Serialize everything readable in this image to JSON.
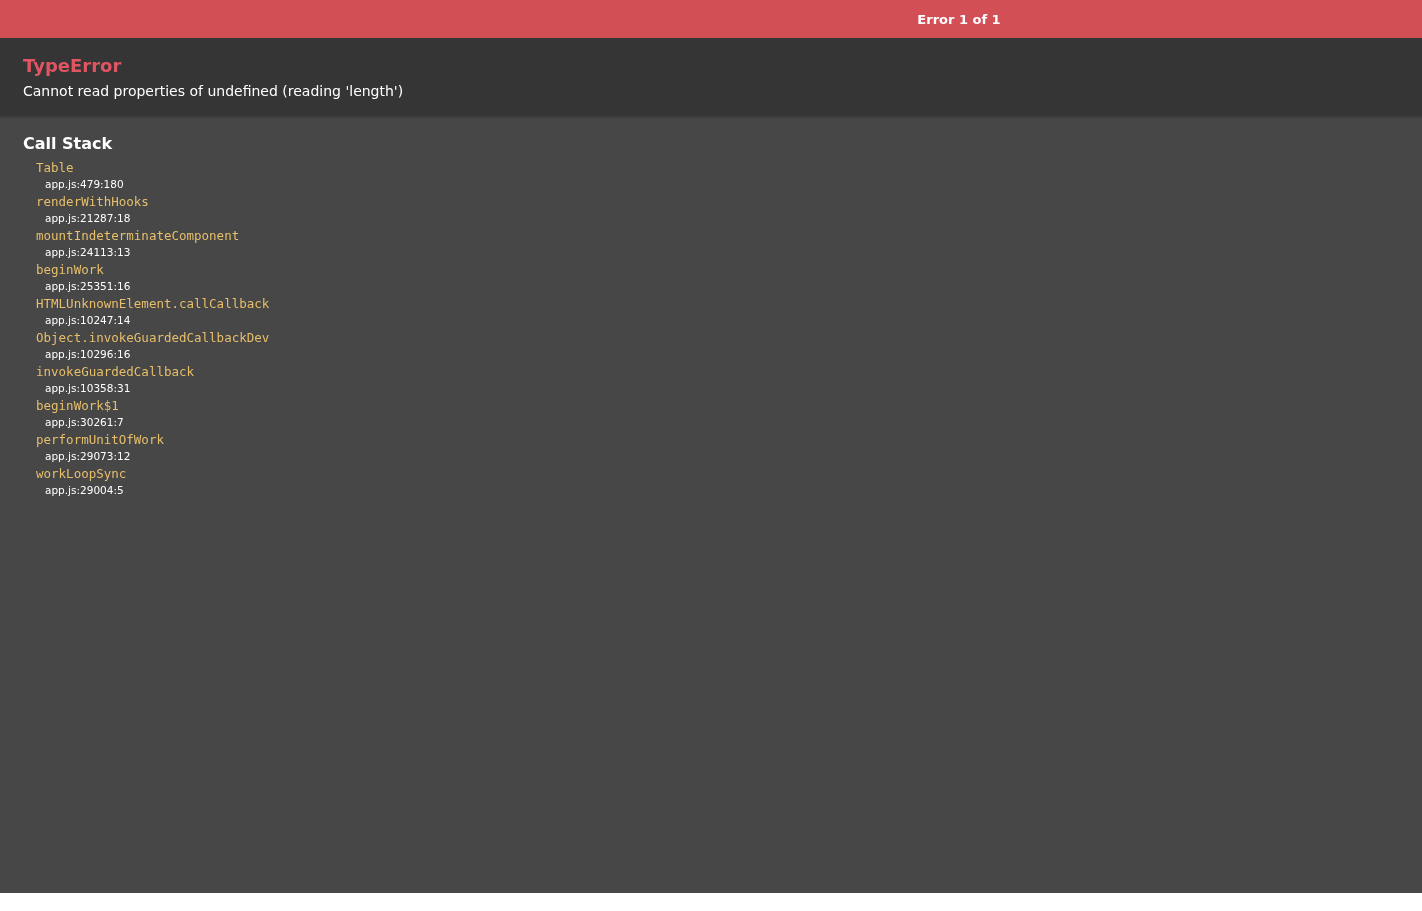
{
  "top_bar": {
    "counter": "Error 1 of 1"
  },
  "error": {
    "type": "TypeError",
    "message": "Cannot read properties of undefined (reading 'length')"
  },
  "call_stack": {
    "title": "Call Stack",
    "frames": [
      {
        "function": "Table",
        "location": "app.js:479:180"
      },
      {
        "function": "renderWithHooks",
        "location": "app.js:21287:18"
      },
      {
        "function": "mountIndeterminateComponent",
        "location": "app.js:24113:13"
      },
      {
        "function": "beginWork",
        "location": "app.js:25351:16"
      },
      {
        "function": "HTMLUnknownElement.callCallback",
        "location": "app.js:10247:14"
      },
      {
        "function": "Object.invokeGuardedCallbackDev",
        "location": "app.js:10296:16"
      },
      {
        "function": "invokeGuardedCallback",
        "location": "app.js:10358:31"
      },
      {
        "function": "beginWork$1",
        "location": "app.js:30261:7"
      },
      {
        "function": "performUnitOfWork",
        "location": "app.js:29073:12"
      },
      {
        "function": "workLoopSync",
        "location": "app.js:29004:5"
      }
    ]
  }
}
